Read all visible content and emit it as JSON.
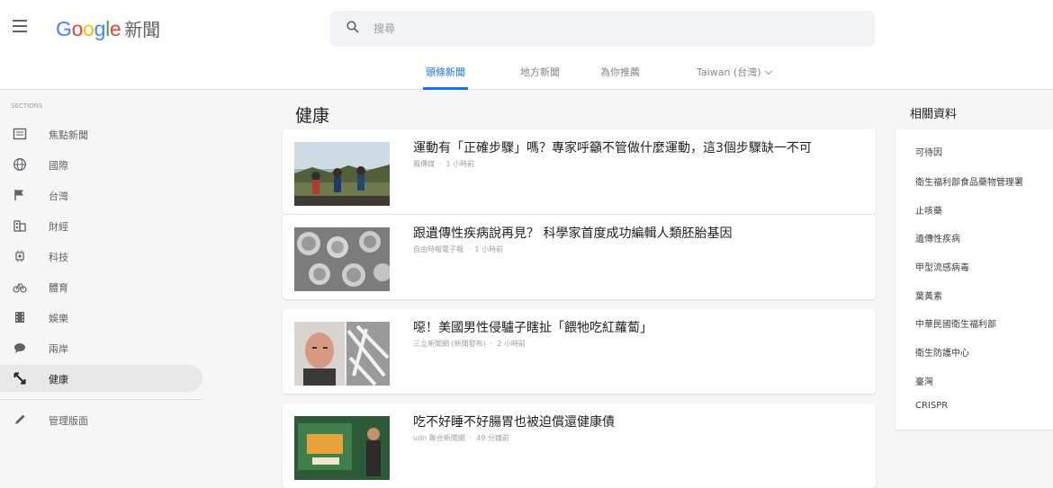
{
  "header": {
    "logo_text": "Google",
    "product_name": "新聞",
    "search_placeholder": "搜尋"
  },
  "tabs": [
    {
      "label": "頭條新聞",
      "active": true
    },
    {
      "label": "地方新聞",
      "active": false
    },
    {
      "label": "為你推薦",
      "active": false
    },
    {
      "label": "Taiwan (台灣)",
      "active": false
    }
  ],
  "sidebar": {
    "section_label": "SECTIONS",
    "items": [
      {
        "label": "焦點新聞",
        "icon": "newspaper-icon"
      },
      {
        "label": "國際",
        "icon": "globe-icon"
      },
      {
        "label": "台灣",
        "icon": "flag-icon"
      },
      {
        "label": "財經",
        "icon": "building-icon"
      },
      {
        "label": "科技",
        "icon": "chip-icon"
      },
      {
        "label": "體育",
        "icon": "bicycle-icon"
      },
      {
        "label": "娛樂",
        "icon": "film-icon"
      },
      {
        "label": "兩岸",
        "icon": "chat-icon"
      },
      {
        "label": "健康",
        "icon": "health-icon",
        "active": true
      }
    ],
    "manage_label": "管理版面",
    "manage_icon": "pencil-icon"
  },
  "main": {
    "section_title": "健康",
    "articles": [
      {
        "headline": "運動有「正確步驟」嗎？專家呼籲不管做什麼運動，這3個步驟缺一不可",
        "source": "風傳媒",
        "time": "1 小時前"
      },
      {
        "headline": "跟遺傳性疾病說再見？ 科學家首度成功編輯人類胚胎基因",
        "source": "自由時報電子報",
        "time": "1 小時前"
      },
      {
        "headline": "噁！美國男性侵驢子瞎扯「餵牠吃紅蘿蔔」",
        "source": "三立新聞網 (新聞發布)",
        "time": "2 小時前"
      },
      {
        "headline": "吃不好睡不好腸胃也被迫償還健康債",
        "source": "udn 聯合新聞網",
        "time": "49 分鐘前"
      }
    ]
  },
  "related": {
    "title": "相關資料",
    "items": [
      "可待因",
      "衛生福利部食品藥物管理署",
      "止咳藥",
      "遺傳性疾病",
      "甲型流感病毒",
      "葉黃素",
      "中華民國衛生福利部",
      "衛生防護中心",
      "臺灣",
      "CRISPR"
    ]
  },
  "colors": {
    "accent": "#1a73e8",
    "background": "#f6f6f6"
  }
}
